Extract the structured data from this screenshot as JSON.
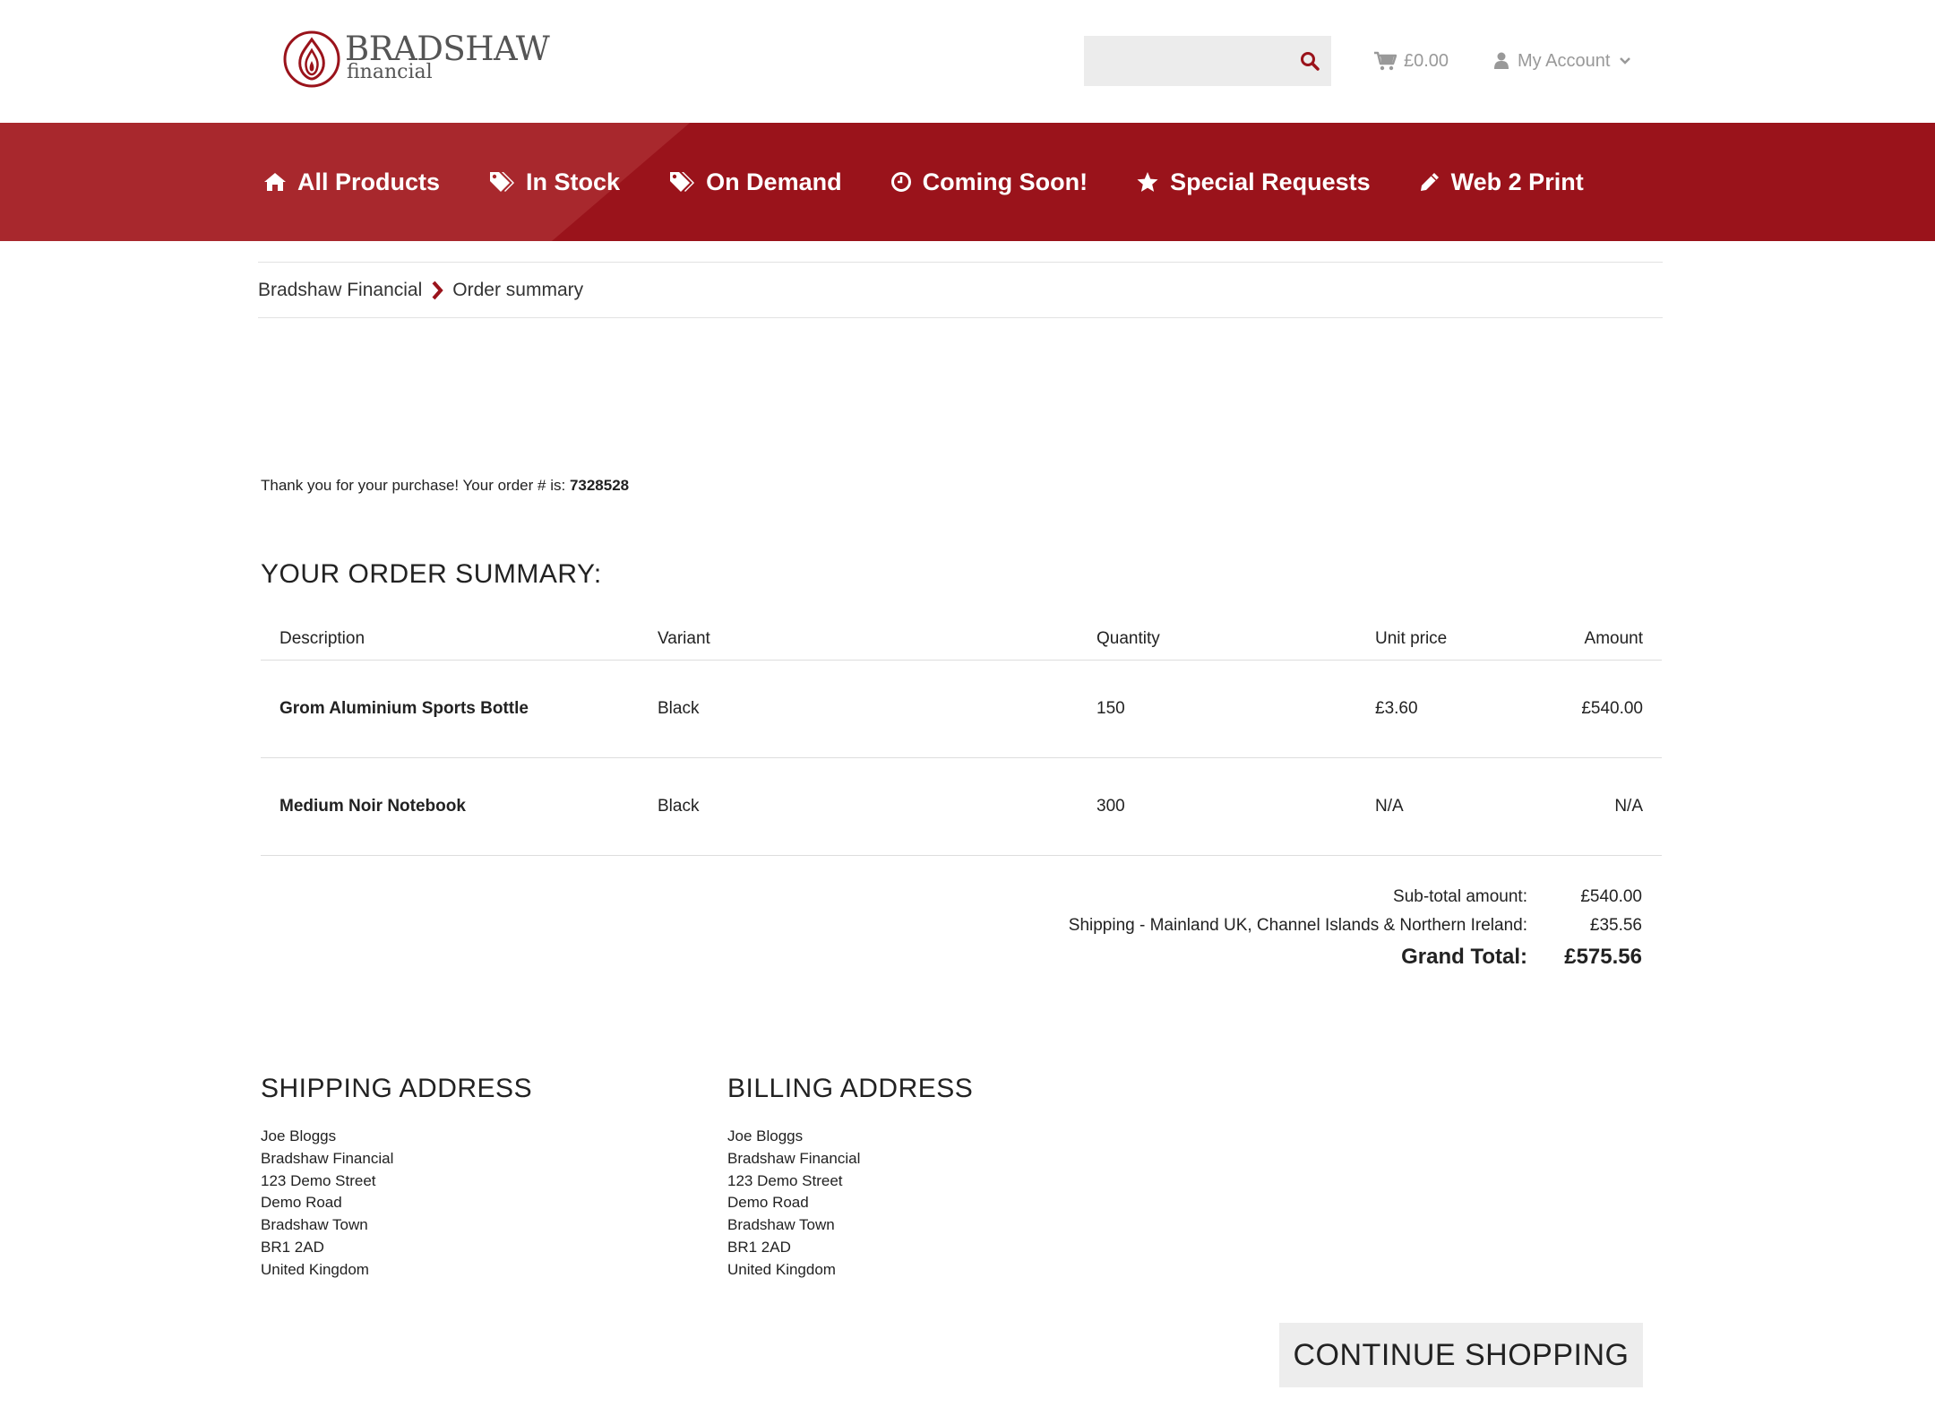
{
  "brand": {
    "name": "BRADSHAW",
    "tagline": "financial",
    "color": "#9a131b"
  },
  "header": {
    "search_placeholder": "",
    "cart_total": "£0.00",
    "account_label": "My Account"
  },
  "nav": {
    "items": [
      {
        "label": "All Products",
        "icon": "home-icon"
      },
      {
        "label": "In Stock",
        "icon": "tags-icon"
      },
      {
        "label": "On Demand",
        "icon": "tags-icon"
      },
      {
        "label": "Coming Soon!",
        "icon": "clock-icon"
      },
      {
        "label": "Special Requests",
        "icon": "star-icon"
      },
      {
        "label": "Web 2 Print",
        "icon": "pencil-icon"
      }
    ]
  },
  "breadcrumb": {
    "home": "Bradshaw Financial",
    "current": "Order summary"
  },
  "order": {
    "thanks_prefix": "Thank you for your purchase! Your order # is:",
    "number": "7328528",
    "summary_title": "YOUR ORDER SUMMARY:",
    "columns": [
      "Description",
      "Variant",
      "Quantity",
      "Unit price",
      "Amount"
    ],
    "rows": [
      {
        "description": "Grom Aluminium Sports Bottle",
        "variant": "Black",
        "quantity": "150",
        "unit_price": "£3.60",
        "amount": "£540.00"
      },
      {
        "description": "Medium Noir Notebook",
        "variant": "Black",
        "quantity": "300",
        "unit_price": "N/A",
        "amount": "N/A"
      }
    ],
    "subtotal_label": "Sub-total amount:",
    "subtotal_value": "£540.00",
    "shipping_label": "Shipping - Mainland UK, Channel Islands & Northern Ireland:",
    "shipping_value": "£35.56",
    "grand_label": "Grand Total:",
    "grand_value": "£575.56"
  },
  "shipping_address": {
    "title": "SHIPPING ADDRESS",
    "lines": [
      "Joe Bloggs",
      "Bradshaw Financial",
      "123 Demo Street",
      "Demo Road",
      "Bradshaw Town",
      "BR1 2AD",
      "United Kingdom"
    ]
  },
  "billing_address": {
    "title": "BILLING ADDRESS",
    "lines": [
      "Joe Bloggs",
      "Bradshaw Financial",
      "123 Demo Street",
      "Demo Road",
      "Bradshaw Town",
      "BR1 2AD",
      "United Kingdom"
    ]
  },
  "continue_label": "CONTINUE SHOPPING"
}
